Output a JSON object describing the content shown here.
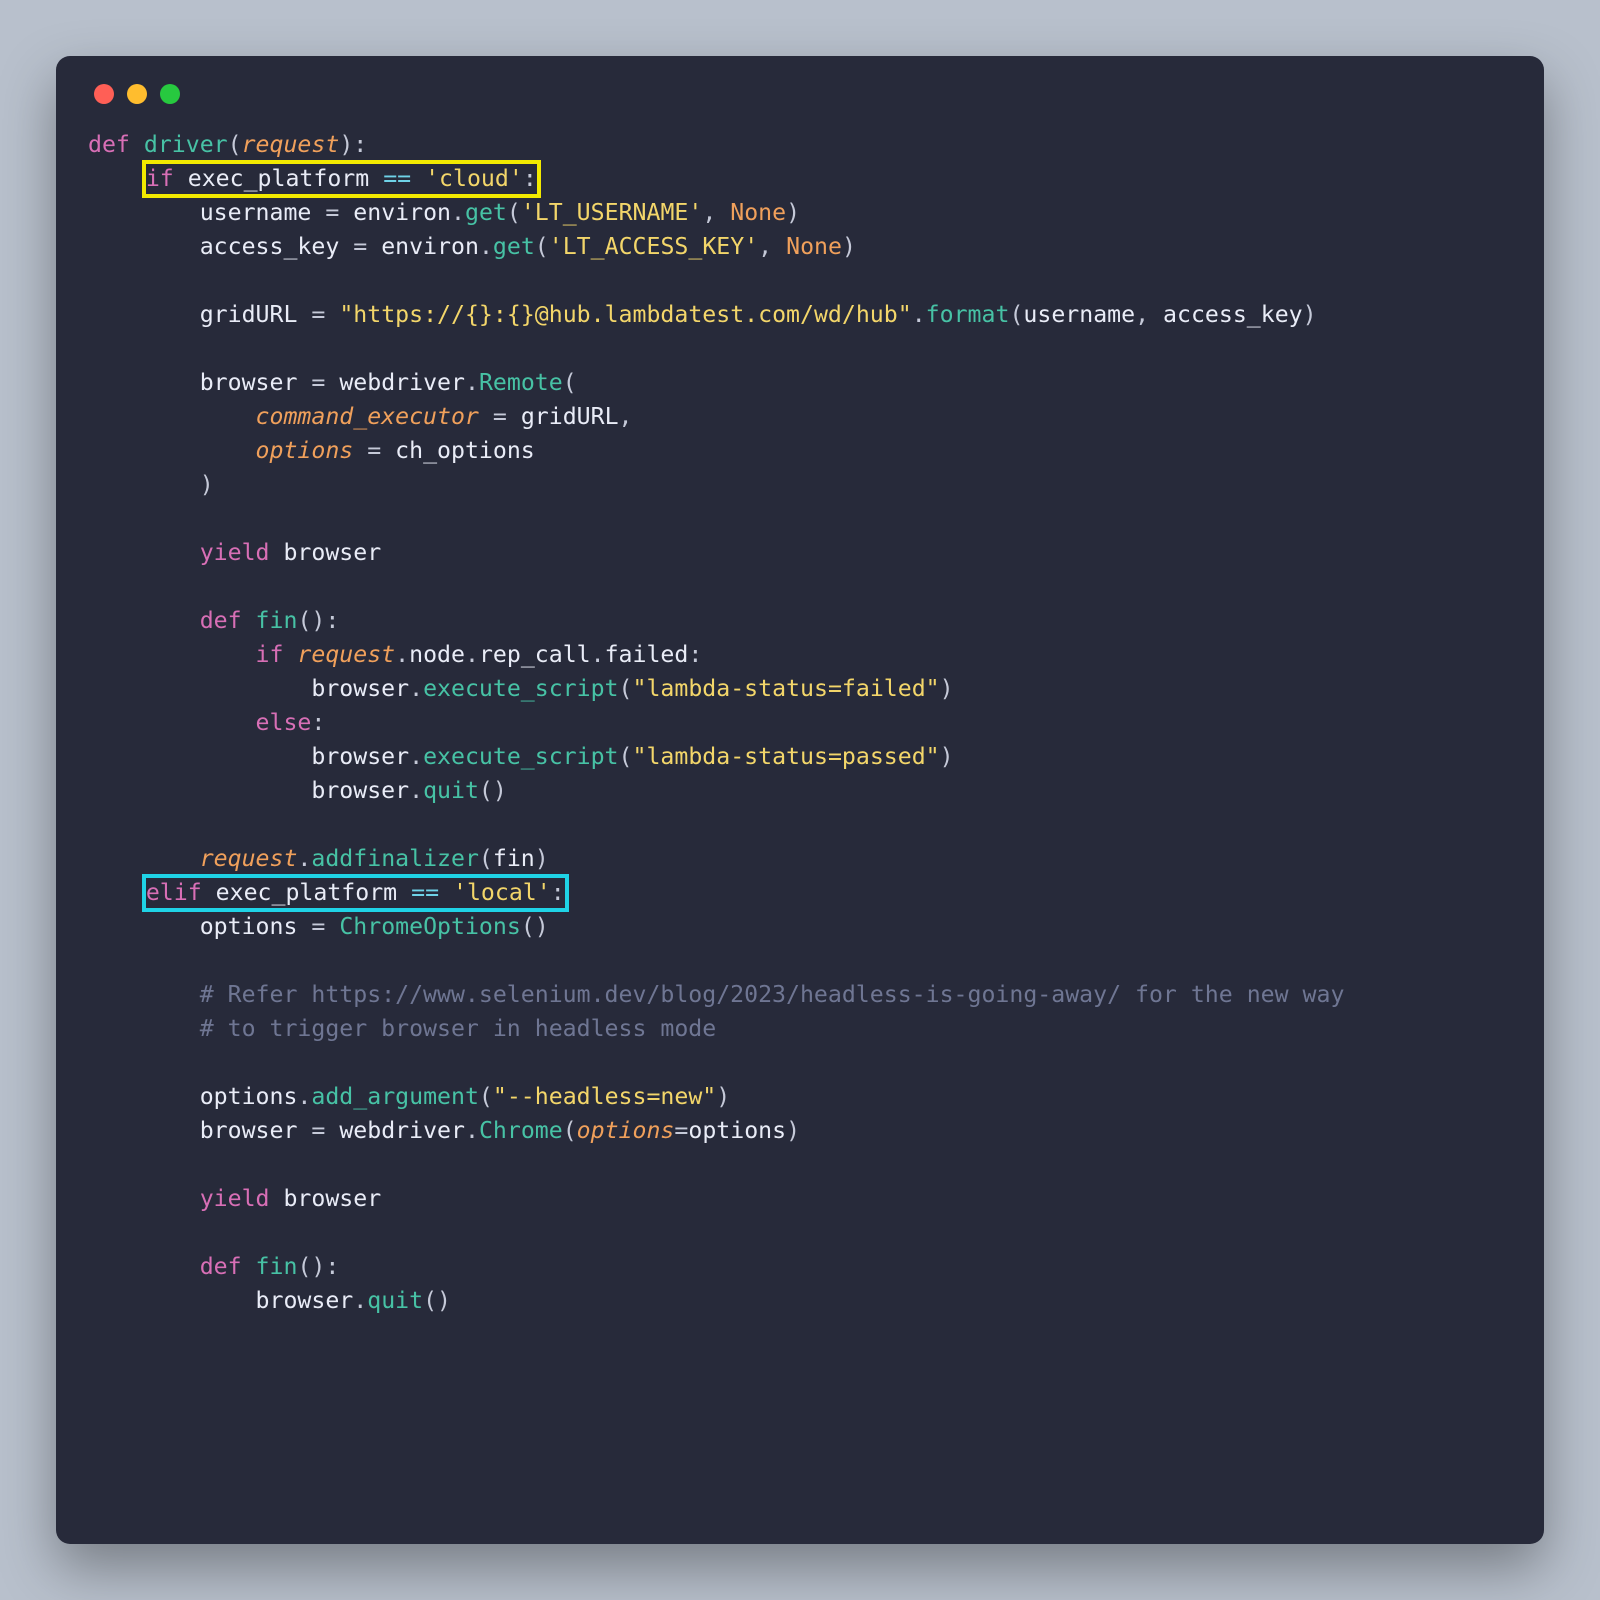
{
  "colors": {
    "bg_outer": "#b8c0cc",
    "bg_window": "#272a3a",
    "traffic_red": "#ff5f56",
    "traffic_yellow": "#ffbd2e",
    "traffic_green": "#27c93f",
    "keyword": "#d86fb6",
    "function": "#47c2a5",
    "param_italic": "#f0a05b",
    "string": "#f3d66a",
    "operator": "#6fd3e8",
    "comment": "#6f7693",
    "highlight_yellow": "#f2e900",
    "highlight_cyan": "#1fd3e6"
  },
  "t": {
    "def": "def",
    "if": "if",
    "elif": "elif",
    "else": "else",
    "yield": "yield",
    "driver": "driver",
    "request": "request",
    "exec_platform": "exec_platform",
    "eqeq": "==",
    "cloud": "'cloud'",
    "local": "'local'",
    "username": "username",
    "access_key": "access_key",
    "environ": "environ",
    "get": "get",
    "LT_USERNAME": "'LT_USERNAME'",
    "LT_ACCESS_KEY": "'LT_ACCESS_KEY'",
    "None": "None",
    "gridURL": "gridURL",
    "gridurl_str": "\"https://{}:{}@hub.lambdatest.com/wd/hub\"",
    "format": "format",
    "browser": "browser",
    "webdriver": "webdriver",
    "Remote": "Remote",
    "command_executor": "command_executor",
    "options": "options",
    "ch_options": "ch_options",
    "fin": "fin",
    "node": "node",
    "rep_call": "rep_call",
    "failed": "failed",
    "execute_script": "execute_script",
    "status_failed": "\"lambda-status=failed\"",
    "status_passed": "\"lambda-status=passed\"",
    "quit": "quit",
    "addfinalizer": "addfinalizer",
    "ChromeOptions": "ChromeOptions",
    "comment1": "# Refer https://www.selenium.dev/blog/2023/headless-is-going-away/ for the new way",
    "comment2": "# to trigger browser in headless mode",
    "add_argument": "add_argument",
    "headless_str": "\"--headless=new\"",
    "Chrome": "Chrome",
    "options_kw": "options"
  }
}
